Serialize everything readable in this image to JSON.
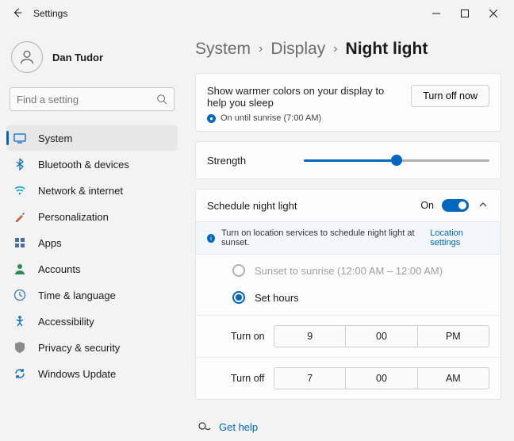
{
  "app": {
    "title": "Settings"
  },
  "account": {
    "name": "Dan Tudor"
  },
  "search": {
    "placeholder": "Find a setting"
  },
  "sidebar": {
    "items": [
      {
        "label": "System",
        "icon": "system-icon",
        "color": "#0067c0"
      },
      {
        "label": "Bluetooth & devices",
        "icon": "bluetooth-icon",
        "color": "#0067c0"
      },
      {
        "label": "Network & internet",
        "icon": "wifi-icon",
        "color": "#00a2c7"
      },
      {
        "label": "Personalization",
        "icon": "brush-icon",
        "color": "#c06a3b"
      },
      {
        "label": "Apps",
        "icon": "apps-icon",
        "color": "#4a6fa5"
      },
      {
        "label": "Accounts",
        "icon": "person-icon",
        "color": "#2e8b57"
      },
      {
        "label": "Time & language",
        "icon": "clock-icon",
        "color": "#3b74c0"
      },
      {
        "label": "Accessibility",
        "icon": "accessibility-icon",
        "color": "#0067c0"
      },
      {
        "label": "Privacy & security",
        "icon": "shield-icon",
        "color": "#8a8a8a"
      },
      {
        "label": "Windows Update",
        "icon": "update-icon",
        "color": "#0067c0"
      }
    ]
  },
  "breadcrumb": {
    "a": "System",
    "b": "Display",
    "c": "Night light"
  },
  "nightlight": {
    "description": "Show warmer colors on your display to help you sleep",
    "status": "On until sunrise (7:00 AM)",
    "turnoff_label": "Turn off now",
    "strength_label": "Strength",
    "strength_value": 50
  },
  "schedule": {
    "title": "Schedule night light",
    "state_label": "On",
    "info_text": "Turn on location services to schedule night light at sunset.",
    "link_label": "Location settings",
    "option_sunset": "Sunset to sunrise (12:00 AM – 12:00 AM)",
    "option_hours": "Set hours",
    "turn_on_label": "Turn on",
    "turn_off_label": "Turn off",
    "on": {
      "hour": "9",
      "minute": "00",
      "ampm": "PM"
    },
    "off": {
      "hour": "7",
      "minute": "00",
      "ampm": "AM"
    }
  },
  "help": {
    "label": "Get help"
  }
}
